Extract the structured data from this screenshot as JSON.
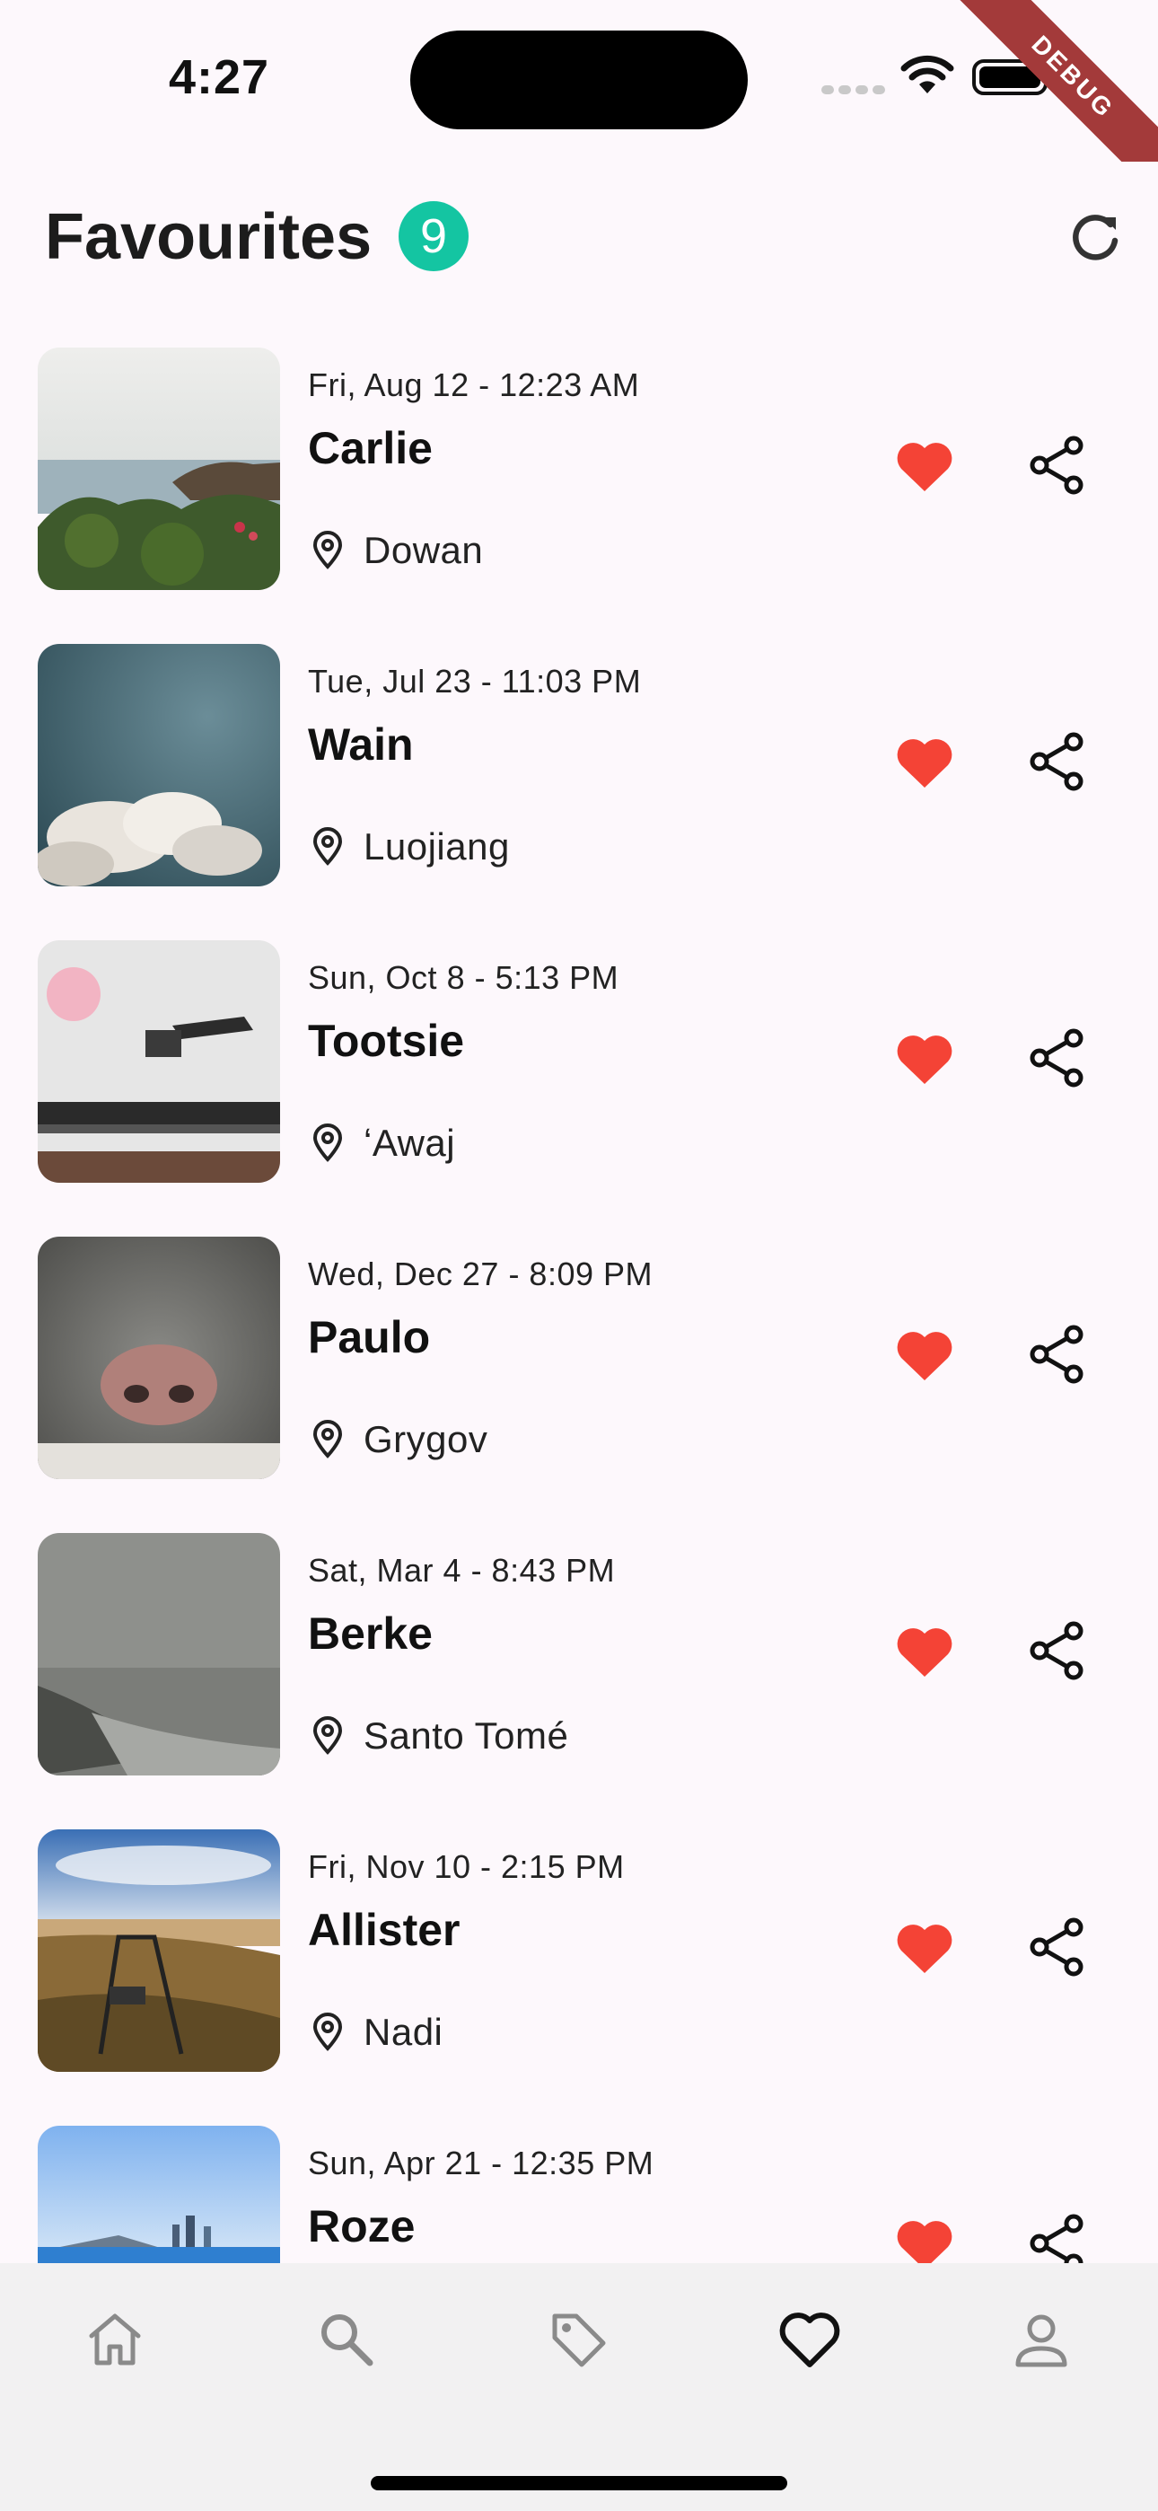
{
  "status_bar": {
    "time": "4:27"
  },
  "debug_banner": "DEBUG",
  "header": {
    "title": "Favourites",
    "count": "9"
  },
  "favourites": [
    {
      "date": "Fri, Aug 12 - 12:23 AM",
      "name": "Carlie",
      "location": "Dowan"
    },
    {
      "date": "Tue, Jul 23 - 11:03 PM",
      "name": "Wain",
      "location": "Luojiang"
    },
    {
      "date": "Sun, Oct 8 - 5:13 PM",
      "name": "Tootsie",
      "location": "ʻAwaj"
    },
    {
      "date": "Wed, Dec 27 - 8:09 PM",
      "name": "Paulo",
      "location": "Grygov"
    },
    {
      "date": "Sat, Mar 4 - 8:43 PM",
      "name": "Berke",
      "location": "Santo Tomé"
    },
    {
      "date": "Fri, Nov 10 - 2:15 PM",
      "name": "Allister",
      "location": "Nadi"
    },
    {
      "date": "Sun, Apr 21 - 12:35 PM",
      "name": "Roze",
      "location": ""
    }
  ],
  "colors": {
    "accent_badge": "#14c5a2",
    "heart": "#f44336",
    "nav_active": "#111111",
    "nav_inactive": "#8a8a8a"
  },
  "nav": [
    {
      "icon": "home-icon"
    },
    {
      "icon": "search-icon"
    },
    {
      "icon": "tag-icon"
    },
    {
      "icon": "heart-outline-icon",
      "active": true
    },
    {
      "icon": "person-icon"
    }
  ]
}
